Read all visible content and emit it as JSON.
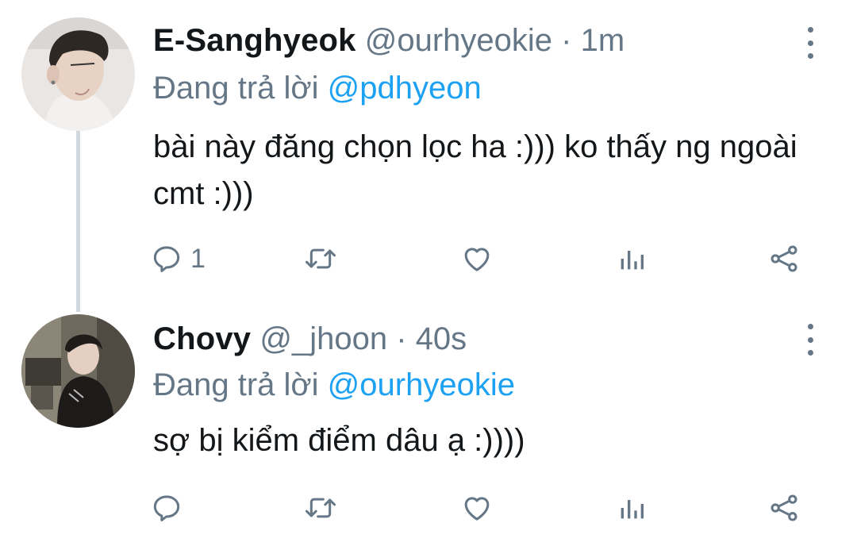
{
  "tweets": [
    {
      "display_name": "E-Sanghyeok",
      "handle": "@ourhyeokie",
      "time": "1m",
      "reply_prefix": "Đang trả lời",
      "reply_to": "@pdhyeon",
      "text": "bài này đăng chọn lọc ha :))) ko thấy ng ngoài cmt :)))",
      "reply_count": "1"
    },
    {
      "display_name": "Chovy",
      "handle": "@_jhoon",
      "time": "40s",
      "reply_prefix": "Đang trả lời",
      "reply_to": "@ourhyeokie",
      "text": "sợ bị kiểm điểm dâu ạ :))))",
      "reply_count": ""
    }
  ],
  "meta_separator": "·",
  "icons": [
    "reply-icon",
    "retweet-icon",
    "like-icon",
    "views-icon",
    "share-icon",
    "more-options-icon"
  ],
  "colors": {
    "accent": "#1da1f2",
    "secondary_text": "#657786",
    "thread_line": "#cfd9de"
  }
}
